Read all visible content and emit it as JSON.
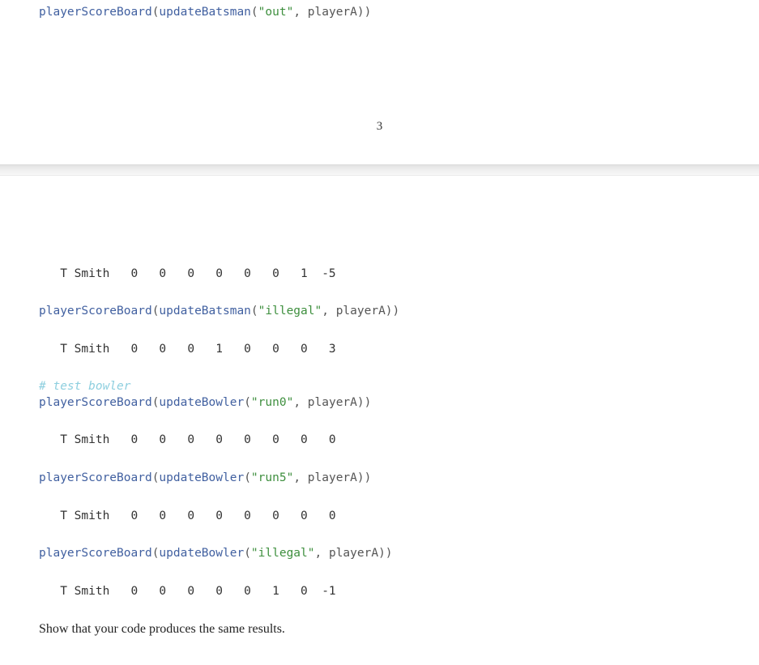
{
  "top_code": {
    "fn1": "playerScoreBoard",
    "fn2": "updateBatsman",
    "str": "\"out\"",
    "arg": ", playerA))"
  },
  "page_number": "3",
  "outputs": {
    "r1": "   T Smith   0   0   0   0   0   0   1  -5",
    "r2": "   T Smith   0   0   0   1   0   0   0   3",
    "r3": "   T Smith   0   0   0   0   0   0   0   0",
    "r4": "   T Smith   0   0   0   0   0   0   0   0",
    "r5": "   T Smith   0   0   0   0   0   1   0  -1"
  },
  "code": {
    "c1_fn1": "playerScoreBoard",
    "c1_fn2": "updateBatsman",
    "c1_str": "\"illegal\"",
    "c1_arg": ", playerA))",
    "comment": "# test bowler",
    "c2_fn1": "playerScoreBoard",
    "c2_fn2": "updateBowler",
    "c2_str": "\"run0\"",
    "c2_arg": ", playerA))",
    "c3_fn1": "playerScoreBoard",
    "c3_fn2": "updateBowler",
    "c3_str": "\"run5\"",
    "c3_arg": ", playerA))",
    "c4_fn1": "playerScoreBoard",
    "c4_fn2": "updateBowler",
    "c4_str": "\"illegal\"",
    "c4_arg": ", playerA))"
  },
  "prose": "Show that your code produces the same results."
}
